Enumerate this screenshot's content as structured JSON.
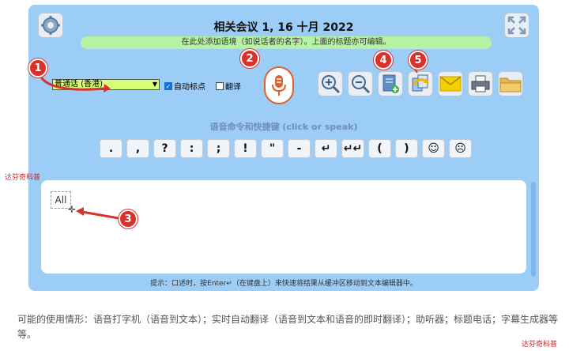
{
  "title": "相关会议 1, 16 十月 2022",
  "context_bar": "在此处添加语境（如说话者的名字）。上面的标题亦可编辑。",
  "language_select": {
    "value": "普通话 (香港)"
  },
  "checkboxes": {
    "auto_punct": {
      "label": "自动标点",
      "checked": true
    },
    "translate": {
      "label": "翻译",
      "checked": false
    }
  },
  "commands_title": "语音命令和快捷键 (click or speak)",
  "keys": [
    ".",
    ",",
    "?",
    ":",
    ";",
    "!",
    "\"",
    "-",
    "↵",
    "↵↵",
    "(",
    ")",
    "☺",
    "☹"
  ],
  "editor": {
    "all_label": "All"
  },
  "tip": "提示：口述时，按Enter↵（在键盘上）来快速将结果从缓冲区移动到文本编辑器中。",
  "description": "可能的使用情形：语音打字机（语音到文本）；实时自动翻译（语音到文本和语音的即时翻译）；助听器；标题电话；字幕生成器等等。",
  "callouts": [
    "1",
    "2",
    "3",
    "4",
    "5"
  ],
  "watermark": "达芬奇科普",
  "colors": {
    "panel": "#9ccdf7",
    "context": "#b7f1a3",
    "accent": "#d9322a",
    "mic": "#e0602a"
  }
}
